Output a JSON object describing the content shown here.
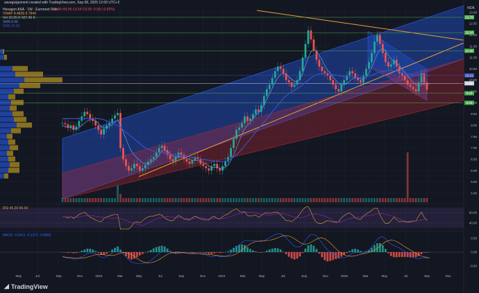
{
  "top_note": "savegisignment created with TradingView.com, Sep 08, 2025 12:00 UTC+2",
  "currency": "NOK",
  "legend": {
    "symbol_line": "Hexagon ASA · 1W · Euronext Oslo",
    "ohlc": "O9.86 H9.96 L9.54 C9.58 -0.08 (-0.82%)",
    "vwap": "VWAP 8.4836 8.7844",
    "vol": "Vol 33.95 K 607.45 K",
    "sma1": "SMA 9.99",
    "sma2": "SMA 10.50"
  },
  "rsi_label": "RSI 45.20 46.04",
  "macd_label": "MACD -0.0411 -0.1271 -0.0859",
  "brand": "TradingView",
  "chart_data": {
    "type": "line",
    "price_ylim": [
      4.6,
      13.3
    ],
    "price_ticks": [
      5.0,
      5.5,
      6.0,
      6.5,
      7.0,
      7.5,
      8.0,
      8.5,
      9.0,
      9.5,
      10.0,
      10.5,
      11.0,
      11.5,
      12.0,
      12.5,
      13.0
    ],
    "price_ticks_label": [
      "5.00",
      "5.50",
      "6.00",
      "6.50",
      "7.00",
      "7.50",
      "8.00",
      "8.50",
      "9.00",
      "9.50",
      "10.00",
      "10.50",
      "11.00",
      "11.50",
      "12.00",
      "12.50",
      "13.00"
    ],
    "key_levels": [
      {
        "label": "12.78",
        "value": 12.78,
        "color": "#4caf50"
      },
      {
        "label": "12.10",
        "value": 12.1,
        "color": "#4caf50"
      },
      {
        "label": "11.30",
        "value": 11.3,
        "color": "#4caf50"
      },
      {
        "label": "10.21",
        "value": 10.21,
        "color": "#3f51b5"
      },
      {
        "label": "9.86",
        "value": 9.86,
        "color": "#d1d4dc"
      },
      {
        "label": "9.42",
        "value": 9.42,
        "color": "#4caf50"
      },
      {
        "label": "9.00",
        "value": 9.0,
        "color": "#4caf50"
      }
    ],
    "x_labels": [
      "May",
      "Jul",
      "Sep",
      "Nov",
      "2023",
      "Mar",
      "May",
      "Jul",
      "Sep",
      "Nov",
      "2024",
      "Mar",
      "May",
      "Jul",
      "Sep",
      "Nov",
      "2025",
      "Mar",
      "May",
      "Jul",
      "Sep",
      "Nov"
    ],
    "x_index": [
      2,
      10,
      19,
      28,
      36,
      45,
      53,
      62,
      71,
      80,
      88,
      97,
      105,
      114,
      123,
      132,
      140,
      149,
      157,
      166,
      175,
      184
    ],
    "closes": [
      8.1,
      8.05,
      7.9,
      8.0,
      7.8,
      7.95,
      8.2,
      8.4,
      8.6,
      8.5,
      8.3,
      8.2,
      8.0,
      7.8,
      7.6,
      7.85,
      8.0,
      8.1,
      8.3,
      8.45,
      8.55,
      7.0,
      6.5,
      6.2,
      6.0,
      6.1,
      6.3,
      6.2,
      6.0,
      6.1,
      6.25,
      6.4,
      6.5,
      6.6,
      6.8,
      7.0,
      7.1,
      6.9,
      6.7,
      6.5,
      6.4,
      6.6,
      6.8,
      6.7,
      6.5,
      6.4,
      6.3,
      6.45,
      6.6,
      6.5,
      6.3,
      6.2,
      6.1,
      6.0,
      6.2,
      6.3,
      6.1,
      6.0,
      6.2,
      6.4,
      6.6,
      7.0,
      7.4,
      7.8,
      7.9,
      8.1,
      8.4,
      8.2,
      8.3,
      8.5,
      8.7,
      8.6,
      8.9,
      9.3,
      9.6,
      9.8,
      10.1,
      10.4,
      10.6,
      10.5,
      10.3,
      10.0,
      9.9,
      9.7,
      9.8,
      10.0,
      10.4,
      11.0,
      11.6,
      12.2,
      11.8,
      11.3,
      10.9,
      10.6,
      10.4,
      10.3,
      10.2,
      10.0,
      9.8,
      9.6,
      9.5,
      9.8,
      10.0,
      10.2,
      10.4,
      10.3,
      10.1,
      10.0,
      9.9,
      10.2,
      10.5,
      10.8,
      11.2,
      11.7,
      12.0,
      11.6,
      11.2,
      10.8,
      10.6,
      10.7,
      10.9,
      10.6,
      10.3,
      10.2,
      10.0,
      9.8,
      9.7,
      9.6,
      9.5,
      9.9,
      10.3,
      9.9,
      9.58
    ],
    "sma_fast": [
      8.0,
      7.95,
      7.9,
      7.9,
      7.85,
      7.85,
      7.9,
      8.0,
      8.1,
      8.2,
      8.25,
      8.25,
      8.2,
      8.1,
      7.95,
      7.9,
      7.9,
      7.95,
      8.05,
      8.15,
      8.25,
      8.0,
      7.7,
      7.4,
      7.1,
      6.85,
      6.7,
      6.55,
      6.45,
      6.35,
      6.3,
      6.3,
      6.35,
      6.45,
      6.55,
      6.7,
      6.85,
      6.9,
      6.85,
      6.75,
      6.65,
      6.6,
      6.6,
      6.6,
      6.6,
      6.55,
      6.5,
      6.45,
      6.45,
      6.45,
      6.4,
      6.35,
      6.3,
      6.2,
      6.15,
      6.15,
      6.15,
      6.1,
      6.1,
      6.15,
      6.25,
      6.45,
      6.7,
      7.0,
      7.3,
      7.6,
      7.85,
      8.0,
      8.15,
      8.3,
      8.45,
      8.55,
      8.7,
      8.9,
      9.15,
      9.4,
      9.65,
      9.9,
      10.1,
      10.25,
      10.3,
      10.25,
      10.15,
      10.05,
      9.95,
      9.95,
      10.05,
      10.3,
      10.65,
      11.0,
      11.25,
      11.35,
      11.3,
      11.1,
      10.9,
      10.65,
      10.45,
      10.3,
      10.15,
      10.0,
      9.85,
      9.8,
      9.8,
      9.85,
      9.95,
      10.05,
      10.1,
      10.1,
      10.05,
      10.05,
      10.15,
      10.3,
      10.55,
      10.85,
      11.15,
      11.35,
      11.4,
      11.3,
      11.1,
      10.95,
      10.85,
      10.75,
      10.65,
      10.5,
      10.35,
      10.2,
      10.05,
      9.9,
      9.8,
      9.75,
      9.8,
      9.85,
      9.82,
      9.85
    ],
    "sma_slow": [
      8.3,
      8.3,
      8.3,
      8.3,
      8.3,
      8.3,
      8.3,
      8.3,
      8.3,
      8.3,
      8.3,
      8.3,
      8.3,
      8.3,
      8.28,
      8.25,
      8.2,
      8.15,
      8.1,
      8.05,
      8.0,
      7.9,
      7.8,
      7.7,
      7.6,
      7.5,
      7.4,
      7.3,
      7.2,
      7.1,
      7.0,
      6.95,
      6.9,
      6.85,
      6.8,
      6.8,
      6.8,
      6.78,
      6.76,
      6.74,
      6.72,
      6.7,
      6.68,
      6.66,
      6.64,
      6.62,
      6.6,
      6.58,
      6.56,
      6.54,
      6.52,
      6.5,
      6.48,
      6.46,
      6.44,
      6.42,
      6.4,
      6.4,
      6.4,
      6.42,
      6.46,
      6.52,
      6.6,
      6.7,
      6.82,
      6.96,
      7.1,
      7.25,
      7.4,
      7.55,
      7.7,
      7.85,
      8.0,
      8.15,
      8.3,
      8.45,
      8.6,
      8.75,
      8.9,
      9.05,
      9.2,
      9.3,
      9.4,
      9.48,
      9.55,
      9.62,
      9.7,
      9.8,
      9.9,
      10.0,
      10.1,
      10.18,
      10.24,
      10.28,
      10.3,
      10.3,
      10.3,
      10.28,
      10.25,
      10.22,
      10.2,
      10.18,
      10.16,
      10.15,
      10.14,
      10.13,
      10.12,
      10.12,
      10.12,
      10.13,
      10.15,
      10.18,
      10.22,
      10.27,
      10.32,
      10.36,
      10.39,
      10.41,
      10.42,
      10.42,
      10.41,
      10.39,
      10.37,
      10.34,
      10.31,
      10.28,
      10.25,
      10.22,
      10.2,
      10.19,
      10.19,
      10.2,
      10.21,
      10.21
    ],
    "volume": [
      1,
      1,
      1,
      1,
      1,
      1,
      1,
      1,
      1,
      1,
      1,
      1,
      1,
      1,
      1,
      1,
      1,
      1,
      1,
      1,
      4,
      2,
      1,
      1,
      1,
      1,
      1,
      1,
      1,
      1,
      1,
      1,
      1,
      1,
      1,
      1,
      1,
      1,
      1,
      1,
      1,
      1,
      1,
      1,
      1,
      1,
      1,
      1,
      1,
      1,
      1,
      1,
      1,
      1,
      1,
      1,
      1,
      1,
      1,
      1,
      1,
      1,
      1,
      1,
      1,
      1,
      1,
      1,
      1,
      1,
      1,
      1,
      1,
      1,
      1,
      1,
      1,
      1,
      1,
      1,
      1,
      1,
      1,
      1,
      1,
      1,
      1,
      1,
      1,
      1,
      1,
      1,
      1,
      1,
      1,
      1,
      1,
      1,
      1,
      1,
      1,
      1,
      1,
      1,
      1,
      1,
      1,
      1,
      1,
      1,
      1,
      1,
      1,
      1,
      1,
      1,
      1,
      1,
      1,
      1,
      1,
      1,
      1,
      1,
      1,
      1,
      1,
      1,
      1,
      1,
      1,
      1,
      1
    ],
    "volume_spike_index": 125,
    "volume_spike_value": 12,
    "rsi_ticks": [
      40.0,
      60.0
    ],
    "rsi_ticks_label": [
      "40.00",
      "60.00"
    ],
    "macd_ticks": [
      -0.5,
      0.0,
      0.5
    ],
    "macd_ticks_label": [
      "-0.50",
      "0.00",
      "0.50"
    ],
    "profile_bins": [
      {
        "price": 10.5,
        "blue": 18,
        "gold": 22
      },
      {
        "price": 10.25,
        "blue": 22,
        "gold": 40
      },
      {
        "price": 10.0,
        "blue": 35,
        "gold": 55
      },
      {
        "price": 9.75,
        "blue": 28,
        "gold": 30
      },
      {
        "price": 9.5,
        "blue": 20,
        "gold": 14
      },
      {
        "price": 9.25,
        "blue": 12,
        "gold": 10
      },
      {
        "price": 9.0,
        "blue": 16,
        "gold": 18
      },
      {
        "price": 8.75,
        "blue": 14,
        "gold": 10
      },
      {
        "price": 8.5,
        "blue": 18,
        "gold": 16
      },
      {
        "price": 8.25,
        "blue": 20,
        "gold": 18
      },
      {
        "price": 8.0,
        "blue": 24,
        "gold": 22
      },
      {
        "price": 7.75,
        "blue": 16,
        "gold": 14
      },
      {
        "price": 7.5,
        "blue": 10,
        "gold": 8
      },
      {
        "price": 7.25,
        "blue": 12,
        "gold": 10
      },
      {
        "price": 7.0,
        "blue": 14,
        "gold": 12
      },
      {
        "price": 6.75,
        "blue": 10,
        "gold": 9
      },
      {
        "price": 6.5,
        "blue": 12,
        "gold": 10
      },
      {
        "price": 6.25,
        "blue": 14,
        "gold": 14
      },
      {
        "price": 6.0,
        "blue": 12,
        "gold": 16
      },
      {
        "price": 5.75,
        "blue": 6,
        "gold": 6
      },
      {
        "price": 11.0,
        "blue": 6,
        "gold": 4
      },
      {
        "price": 11.25,
        "blue": 4,
        "gold": 2
      }
    ],
    "colors": {
      "bg": "#131722",
      "up": "#26a69a",
      "down": "#ef5350",
      "sma_fast": "#5d8fd6",
      "sma_slow": "#3b4fc7",
      "trend": "#f0a030",
      "channel_blue": "#2962ff",
      "channel_red": "#b22833",
      "rsi": "#e0a040",
      "rsi_ma": "#9c27b0",
      "macd": "#2962ff",
      "signal": "#f0a030"
    }
  }
}
